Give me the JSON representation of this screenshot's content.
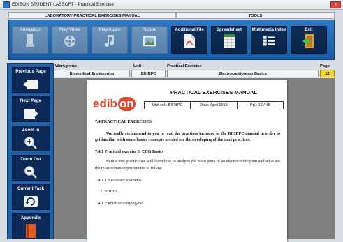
{
  "window": {
    "title": "EDIBON STUDENT LABSOFT - Practical Exercise",
    "close_label": "x"
  },
  "header": {
    "left": "LABORATORY PRACTICAL EXERCISES MANUAL",
    "right": "TOOLS"
  },
  "toolbar": {
    "animation": "Animation",
    "play_video": "Play Video",
    "play_audio": "Play Audio",
    "picture": "Picture",
    "additional_file": "Additional File",
    "spreadsheet": "Spreadsheet",
    "multimedia_index": "Multimedia Index",
    "exit": "Exit"
  },
  "sidebar": {
    "previous_page": "Previous Page",
    "next_page": "Next Page",
    "zoom_in": "Zoom In",
    "zoom_out": "Zoom Out",
    "current_task": "Current Task",
    "appendix": "Appendix"
  },
  "info": {
    "workgroup_label": "Workgroup",
    "unit_label": "Unit",
    "exercise_label": "Practical Exercise",
    "page_label": "Page",
    "workgroup": "Biomedical Engineering",
    "unit": "BIHBPC",
    "exercise": "Electrocardiogram Basics",
    "page": "12"
  },
  "document": {
    "logo_text": "edibon",
    "title": "PRACTICAL EXERCISES MANUAL",
    "unit_ref": "Unit ref.: BIHBPC",
    "date": "Date: April 2015",
    "page": "Pg.: 12 / 48",
    "heading": "7.4  PRACTICAL EXERCISES",
    "intro": "We really recommend to you to read the practices included in the BIHBPC manual in order to get familiar with some basics concepts needed for the developing of the next practices.",
    "sub1": "7.4.1  Practical exercise 0: ECG Basics",
    "sub1_text": "In this first practice we will learn how to analyze the main parts of an electrocardiogram and what are the most common procedures to follow.",
    "sub2": "7.4.1.1  Necessary elements",
    "bullet": "BIHBPC",
    "sub3": "7.4.1.2  Practice carrying-out"
  }
}
